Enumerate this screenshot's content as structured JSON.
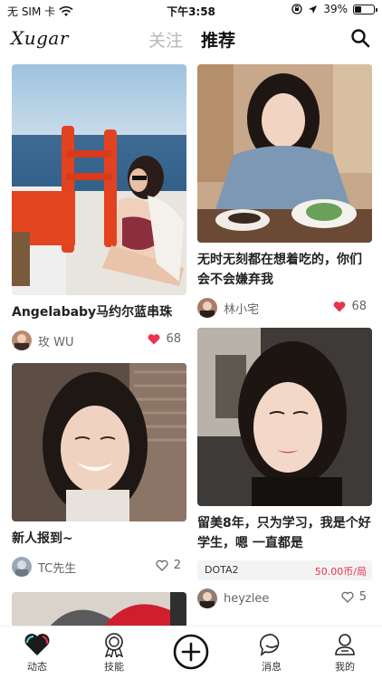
{
  "status": {
    "carrier": "无 SIM 卡",
    "time": "下午3:58",
    "battery": "39%",
    "battery_level": 0.39
  },
  "header": {
    "logo": "Xugar",
    "tab_follow": "关注",
    "tab_recommend": "推荐",
    "search_icon": "search-icon"
  },
  "feed": [
    {
      "title": "Angelababy马约尔蓝串珠",
      "author": "玫 WU",
      "likes": "68",
      "liked": true
    },
    {
      "title": "新人报到~",
      "author": "TC先生",
      "likes": "2",
      "liked": false
    },
    {
      "title": "无时无刻都在想着吃的，你们会不会嫌弃我",
      "author": "林小宅",
      "likes": "68",
      "liked": true
    },
    {
      "title": "留美8年，只为学习，我是个好学生，嗯 一直都是",
      "author": "heyzlee",
      "likes": "5",
      "liked": false,
      "game": "DOTA2",
      "price": "50.00币/局"
    }
  ],
  "nav": {
    "items": [
      {
        "label": "动态",
        "icon": "heart-icon",
        "active": true
      },
      {
        "label": "技能",
        "icon": "medal-icon",
        "active": false
      },
      {
        "label": "",
        "icon": "plus-circle-icon",
        "active": false
      },
      {
        "label": "消息",
        "icon": "message-icon",
        "active": false
      },
      {
        "label": "我的",
        "icon": "profile-icon",
        "active": false
      }
    ]
  },
  "colors": {
    "accent_red": "#e8344e",
    "tab_inactive": "#b8b8b8",
    "text_dark": "#222222"
  }
}
